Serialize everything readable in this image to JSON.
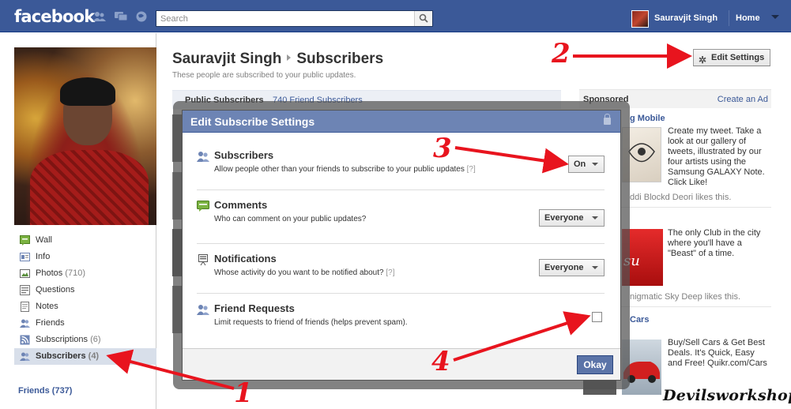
{
  "topbar": {
    "logo": "facebook",
    "search_placeholder": "Search",
    "user_name": "Sauravjit Singh",
    "home": "Home"
  },
  "sidebar": {
    "items": [
      {
        "label": "Wall",
        "count": "",
        "icon": "wall-icon"
      },
      {
        "label": "Info",
        "count": "",
        "icon": "info-icon"
      },
      {
        "label": "Photos",
        "count": " (710)",
        "icon": "photos-icon"
      },
      {
        "label": "Questions",
        "count": "",
        "icon": "questions-icon"
      },
      {
        "label": "Notes",
        "count": "",
        "icon": "notes-icon"
      },
      {
        "label": "Friends",
        "count": "",
        "icon": "friends-icon"
      },
      {
        "label": "Subscriptions",
        "count": " (6)",
        "icon": "subscriptions-icon"
      },
      {
        "label": "Subscribers",
        "count": " (4)",
        "icon": "subscribers-icon",
        "active": true
      }
    ],
    "friends_heading": "Friends (737)"
  },
  "main": {
    "title_name": "Sauravjit Singh",
    "title_section": "Subscribers",
    "subtitle": "These people are subscribed to your public updates.",
    "edit_settings": "Edit Settings",
    "public_subscribers_label": "Public Subscribers",
    "public_subscribers_link": "740 Friend Subscribers"
  },
  "sponsored": {
    "heading": "Sponsored",
    "create_ad": "Create an Ad",
    "ads": [
      {
        "head_partial": "g Mobile",
        "text": "Create my tweet. Take a look at our gallery of tweets, illustrated by our four artists using the Samsung GALAXY Note. Click Like!",
        "like": "ddi Blockd Deori likes this."
      },
      {
        "head_partial": "",
        "text": "The only Club in the city where you'll have a \"Beast\" of a time.",
        "like": "nigmatic Sky Deep likes this."
      },
      {
        "head_partial": "Cars",
        "text": "Buy/Sell Cars & Get Best Deals. It's Quick, Easy and Free! Quikr.com/Cars",
        "like": ""
      }
    ]
  },
  "dialog": {
    "title": "Edit Subscribe Settings",
    "settings": [
      {
        "title": "Subscribers",
        "desc": "Allow people other than your friends to subscribe to your public updates",
        "help": "[?]",
        "control": "On"
      },
      {
        "title": "Comments",
        "desc": "Who can comment on your public updates?",
        "help": "",
        "control": "Everyone"
      },
      {
        "title": "Notifications",
        "desc": "Whose activity do you want to be notified about?",
        "help": "[?]",
        "control": "Everyone"
      },
      {
        "title": "Friend Requests",
        "desc": "Limit requests to friend of friends (helps prevent spam).",
        "help": "",
        "control": "checkbox",
        "checked": false
      }
    ],
    "okay": "Okay"
  },
  "annotations": [
    "1",
    "2",
    "3",
    "4"
  ],
  "watermark": "Devilsworkshop",
  "colors": {
    "brand": "#3b5998",
    "dialog_header": "#6d84b4",
    "annotation": "#e8141e"
  }
}
